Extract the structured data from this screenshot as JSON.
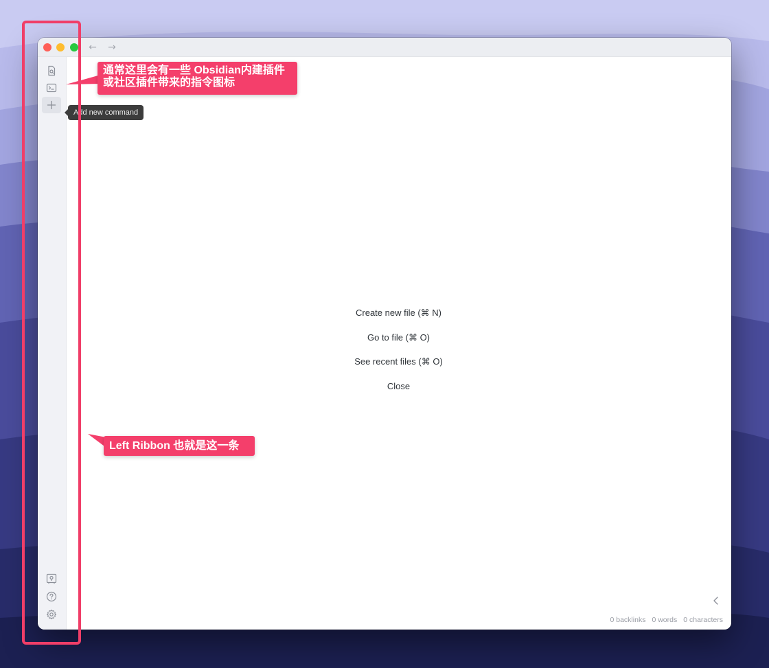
{
  "window": {
    "nav_back": "←",
    "nav_forward": "→"
  },
  "ribbon": {
    "top_items": [
      {
        "name": "open-quick-switcher",
        "icon": "file-search-icon"
      },
      {
        "name": "open-command-palette",
        "icon": "terminal-icon"
      },
      {
        "name": "add-new-command",
        "icon": "plus-icon"
      }
    ],
    "bottom_items": [
      {
        "name": "open-vault",
        "icon": "vault-icon"
      },
      {
        "name": "help",
        "icon": "help-icon"
      },
      {
        "name": "settings",
        "icon": "gear-icon"
      },
      {
        "name": "expand-sidebar",
        "icon": "chevron-right-icon"
      }
    ],
    "tooltip": "Add new command"
  },
  "empty_state": {
    "actions": [
      "Create new file (⌘ N)",
      "Go to file (⌘ O)",
      "See recent files (⌘ O)",
      "Close"
    ]
  },
  "status_bar": {
    "backlinks": "0 backlinks",
    "words": "0 words",
    "characters": "0 characters"
  },
  "annotations": {
    "callout_top": "通常这里会有一些 Obsidian内建插件或社区插件带来的指令图标",
    "callout_bottom": "Left Ribbon 也就是这一条",
    "accent_color": "#f43f6b"
  }
}
